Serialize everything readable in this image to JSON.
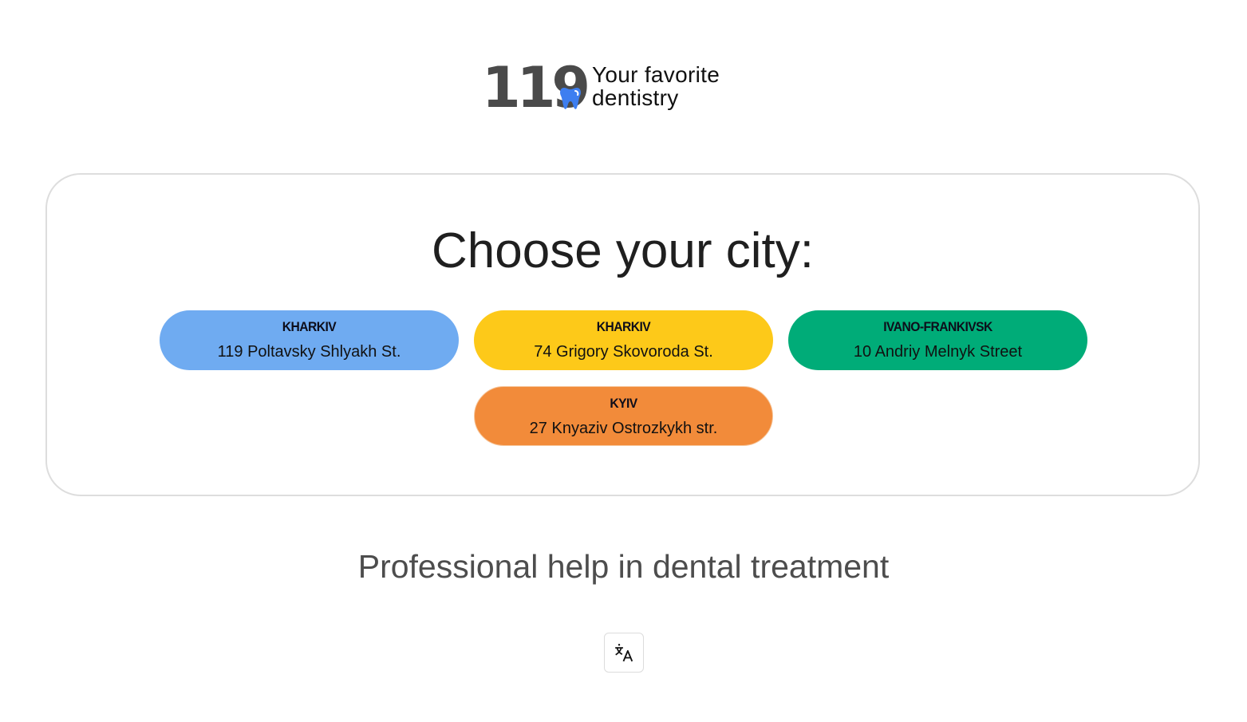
{
  "header": {
    "logo_number": "119",
    "logo_icon": "tooth-icon",
    "tagline_line1": "Your favorite",
    "tagline_line2": "dentistry"
  },
  "city_selector": {
    "title": "Choose your city:",
    "cities": [
      {
        "name": "KHARKIV",
        "address": "119 Poltavsky Shlyakh St.",
        "color": "#6fabf1"
      },
      {
        "name": "KHARKIV",
        "address": "74 Grigory Skovoroda St.",
        "color": "#fdc919"
      },
      {
        "name": "IVANO-FRANKIVSK",
        "address": "10 Andriy Melnyk Street",
        "color": "#00ac78"
      },
      {
        "name": "KYIV",
        "address": "27 Knyaziv Ostrozkykh str.",
        "color": "#f28b3a"
      }
    ]
  },
  "footer": {
    "tagline": "Professional help in dental treatment",
    "language_button_icon": "translate-icon"
  },
  "colors": {
    "logo_gray": "#4a4a4a",
    "tooth_blue": "#3d7ef0",
    "panel_border": "#dddddd"
  }
}
